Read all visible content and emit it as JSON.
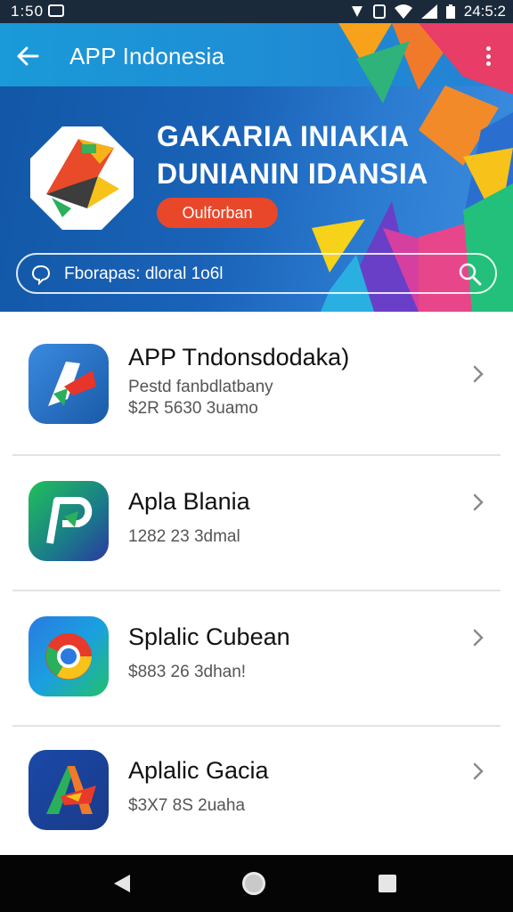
{
  "status_bar": {
    "time_left": "1:50",
    "time_right": "24:5:2"
  },
  "header": {
    "title": "APP Indonesia"
  },
  "hero": {
    "headline_line1": "GAKARIA INIAKIA",
    "headline_line2": "DUNIANIN IDANSIA",
    "cta_label": "Oulforban",
    "search_text": "Fborapas: dloral 1o6l"
  },
  "apps": [
    {
      "name": "APP Tndonsdodaka)",
      "line1": "Pestd fanbdlatbany",
      "line2": "$2R 5630 3uamo"
    },
    {
      "name": "Apla Blania",
      "line1": "",
      "line2": "1282 23  3dmal"
    },
    {
      "name": "Splalic Cubean",
      "line1": "",
      "line2": "$883 26  3dhan!"
    },
    {
      "name": "Aplalic Gacia",
      "line1": "",
      "line2": "$3X7 8S  2uaha"
    }
  ],
  "colors": {
    "header_blue": "#1a9ad8",
    "hero_blue": "#1257a6",
    "cta_orange": "#e8472a",
    "nav_black": "#050505"
  },
  "icons": {
    "back": "arrow-left-icon",
    "menu": "more-vert-icon",
    "search": "search-icon",
    "chat": "chat-bubble-icon",
    "chevron": "chevron-right-icon"
  }
}
